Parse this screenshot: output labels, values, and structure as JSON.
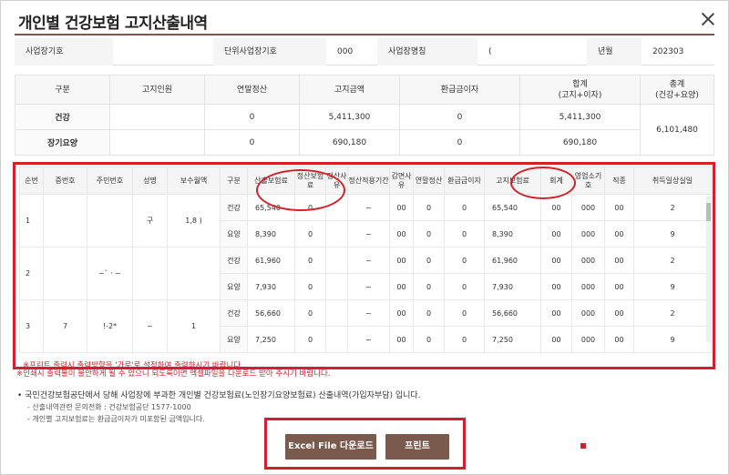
{
  "modal": {
    "title": "개인별 건강보험 고지산출내역"
  },
  "info_bar": {
    "workplace_no_label": "사업장기호",
    "workplace_no_value": "",
    "unit_no_label": "단위사업장기호",
    "unit_no_value": "000",
    "workplace_name_label": "사업장명칭",
    "workplace_name_value": "(",
    "year_month_label": "년월",
    "year_month_value": "202303"
  },
  "summary": {
    "headers": [
      "구분",
      "고지인원",
      "연말정산",
      "고지금액",
      "환급금이자",
      "합계\n(고지+이자)",
      "총계\n(건강+요양)"
    ],
    "rows": [
      {
        "label": "건강",
        "persons": "",
        "settlement": "0",
        "amount": "5,411,300",
        "interest": "0",
        "sum": "5,411,300"
      },
      {
        "label": "장기요양",
        "persons": "",
        "settlement": "0",
        "amount": "690,180",
        "interest": "0",
        "sum": "690,180"
      }
    ],
    "total": "6,101,480"
  },
  "detail": {
    "headers": [
      "순번",
      "증번호",
      "주민번호",
      "성명",
      "보수월액",
      "구분",
      "산출보험료",
      "정산보험료",
      "정산사유",
      "정산적용기간",
      "감면사유",
      "연말정산",
      "환급금이자",
      "고지보험료",
      "회계",
      "영업소기호",
      "직종",
      "취득일상실일"
    ],
    "rows": [
      {
        "seq": "1",
        "card": "",
        "rrn": "",
        "name": "구",
        "pay": "1,8 )",
        "type": "건강",
        "calc": "65,540",
        "adj": "0",
        "reason": "",
        "period": "~",
        "reduct": "00",
        "yearend": "0",
        "interest": "0",
        "notice": "65,540",
        "acct": "00",
        "office": "000",
        "job": "00",
        "date": "2"
      },
      {
        "seq": "",
        "card": "",
        "rrn": "",
        "name": "",
        "pay": "",
        "type": "요양",
        "calc": "8,390",
        "adj": "0",
        "reason": "",
        "period": "~",
        "reduct": "00",
        "yearend": "0",
        "interest": "0",
        "notice": "8,390",
        "acct": "00",
        "office": "000",
        "job": "00",
        "date": "9"
      },
      {
        "seq": "2",
        "card": "",
        "rrn": "~` · ~",
        "name": "",
        "pay": "",
        "type": "건강",
        "calc": "61,960",
        "adj": "0",
        "reason": "",
        "period": "~",
        "reduct": "00",
        "yearend": "0",
        "interest": "0",
        "notice": "61,960",
        "acct": "00",
        "office": "000",
        "job": "00",
        "date": "2"
      },
      {
        "seq": "",
        "card": "",
        "rrn": "",
        "name": "",
        "pay": "",
        "type": "요양",
        "calc": "7,930",
        "adj": "0",
        "reason": "",
        "period": "~",
        "reduct": "00",
        "yearend": "0",
        "interest": "0",
        "notice": "7,930",
        "acct": "00",
        "office": "000",
        "job": "00",
        "date": "9"
      },
      {
        "seq": "3",
        "card": "7",
        "rrn": "!-2*",
        "name": "~",
        "pay": "1",
        "type": "건강",
        "calc": "56,660",
        "adj": "0",
        "reason": "",
        "period": "~",
        "reduct": "00",
        "yearend": "0",
        "interest": "0",
        "notice": "56,660",
        "acct": "00",
        "office": "000",
        "job": "00",
        "date": "2"
      },
      {
        "seq": "",
        "card": "",
        "rrn": "",
        "name": "",
        "pay": "",
        "type": "요양",
        "calc": "7,250",
        "adj": "0",
        "reason": "",
        "period": "~",
        "reduct": "00",
        "yearend": "0",
        "interest": "0",
        "notice": "7,250",
        "acct": "00",
        "office": "000",
        "job": "00",
        "date": "9"
      }
    ],
    "print_note": "※프린트 출력시 출력방향을 '가로'로 설정하여 출력하시기 바랍니다.",
    "under_note": "※인쇄시 출력물이 불안하게 될 수 있으니 되도록이면 엑셀파일을 다운로드 받아 주시기 바랍니다."
  },
  "notes": {
    "main": "• 국민건강보험공단에서 당해 사업장에 부과한 개인별 건강보험료(노인장기요양보험료) 산출내역(가입자부담) 입니다.",
    "contact": "- 산출내역관련 문의전화 : 건강보험공단 1577-1000",
    "refund": "- 개인별 고지보험료는 환급금이자가 미포함된 금액입니다."
  },
  "buttons": {
    "excel": "Excel File 다운로드",
    "print": "프린트"
  },
  "colors": {
    "accent": "#7b5a4e",
    "highlight": "#d4202a"
  }
}
